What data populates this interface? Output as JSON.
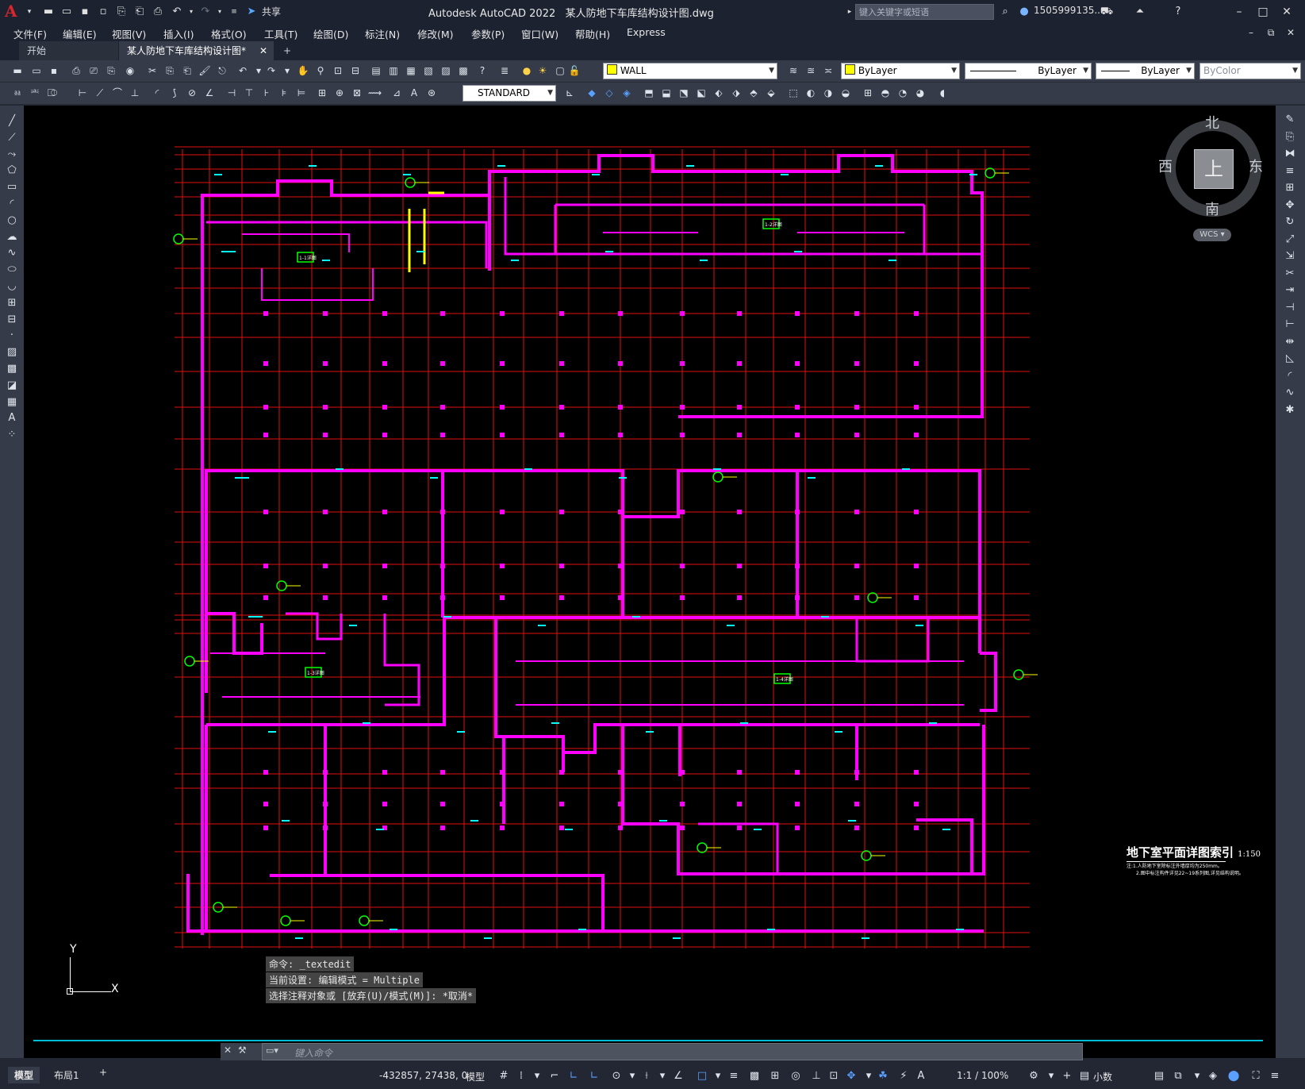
{
  "app": {
    "title": "Autodesk AutoCAD 2022",
    "filename": "某人防地下车库结构设计图.dwg",
    "search_placeholder": "键入关键字或短语",
    "user": "1505999135...",
    "share": "共享"
  },
  "menu": [
    "文件(F)",
    "编辑(E)",
    "视图(V)",
    "插入(I)",
    "格式(O)",
    "工具(T)",
    "绘图(D)",
    "标注(N)",
    "修改(M)",
    "参数(P)",
    "窗口(W)",
    "帮助(H)",
    "Express"
  ],
  "tabs": {
    "start": "开始",
    "drawing": "某人防地下车库结构设计图*",
    "add": "+"
  },
  "properties": {
    "layer": "WALL",
    "color": "ByLayer",
    "linetype": "ByLayer",
    "lineweight": "ByLayer",
    "plotstyle": "ByColor",
    "textstyle": "STANDARD"
  },
  "viewcube": {
    "north": "北",
    "south": "南",
    "east": "东",
    "west": "西",
    "face": "上",
    "wcs": "WCS"
  },
  "drawing": {
    "legend_title": "地下室平面详图索引",
    "legend_scale": "1:150",
    "legend_note1": "注:1.人防地下室除标注外墙厚均为250mm。",
    "legend_note2": "2.图中标注构件详见22~19系列图,详见结构说明。",
    "tags": [
      "1-1详图",
      "1-2详图",
      "1-3详图",
      "1-4详图"
    ]
  },
  "ucs": {
    "x": "X",
    "y": "Y"
  },
  "command": {
    "line1": "命令: _textedit",
    "line2": "当前设置: 编辑模式 = Multiple",
    "line3": "选择注释对象或 [放弃(U)/模式(M)]: *取消*",
    "placeholder": "键入命令"
  },
  "status": {
    "tab_model": "模型",
    "tab_layout": "布局1",
    "coords": "-432857, 27438, 0",
    "space": "模型",
    "scale": "1:1 / 100%",
    "units": "小数"
  },
  "colors": {
    "wall": "#ff00ff",
    "axis": "#e11010",
    "dim": "#00ffff",
    "tag": "#00ff00",
    "highlight": "#ffff00"
  }
}
